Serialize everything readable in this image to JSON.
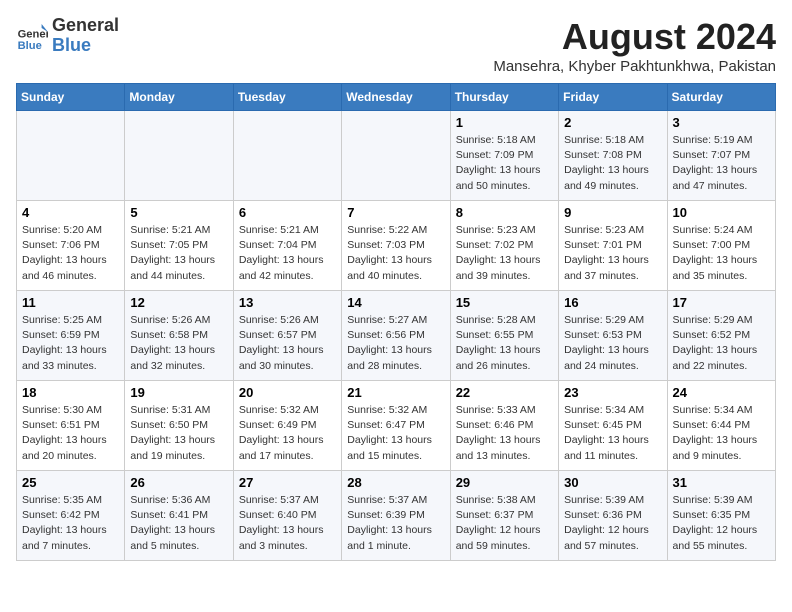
{
  "logo": {
    "general": "General",
    "blue": "Blue"
  },
  "title": "August 2024",
  "subtitle": "Mansehra, Khyber Pakhtunkhwa, Pakistan",
  "days_of_week": [
    "Sunday",
    "Monday",
    "Tuesday",
    "Wednesday",
    "Thursday",
    "Friday",
    "Saturday"
  ],
  "weeks": [
    [
      {
        "day": "",
        "info": ""
      },
      {
        "day": "",
        "info": ""
      },
      {
        "day": "",
        "info": ""
      },
      {
        "day": "",
        "info": ""
      },
      {
        "day": "1",
        "info": "Sunrise: 5:18 AM\nSunset: 7:09 PM\nDaylight: 13 hours\nand 50 minutes."
      },
      {
        "day": "2",
        "info": "Sunrise: 5:18 AM\nSunset: 7:08 PM\nDaylight: 13 hours\nand 49 minutes."
      },
      {
        "day": "3",
        "info": "Sunrise: 5:19 AM\nSunset: 7:07 PM\nDaylight: 13 hours\nand 47 minutes."
      }
    ],
    [
      {
        "day": "4",
        "info": "Sunrise: 5:20 AM\nSunset: 7:06 PM\nDaylight: 13 hours\nand 46 minutes."
      },
      {
        "day": "5",
        "info": "Sunrise: 5:21 AM\nSunset: 7:05 PM\nDaylight: 13 hours\nand 44 minutes."
      },
      {
        "day": "6",
        "info": "Sunrise: 5:21 AM\nSunset: 7:04 PM\nDaylight: 13 hours\nand 42 minutes."
      },
      {
        "day": "7",
        "info": "Sunrise: 5:22 AM\nSunset: 7:03 PM\nDaylight: 13 hours\nand 40 minutes."
      },
      {
        "day": "8",
        "info": "Sunrise: 5:23 AM\nSunset: 7:02 PM\nDaylight: 13 hours\nand 39 minutes."
      },
      {
        "day": "9",
        "info": "Sunrise: 5:23 AM\nSunset: 7:01 PM\nDaylight: 13 hours\nand 37 minutes."
      },
      {
        "day": "10",
        "info": "Sunrise: 5:24 AM\nSunset: 7:00 PM\nDaylight: 13 hours\nand 35 minutes."
      }
    ],
    [
      {
        "day": "11",
        "info": "Sunrise: 5:25 AM\nSunset: 6:59 PM\nDaylight: 13 hours\nand 33 minutes."
      },
      {
        "day": "12",
        "info": "Sunrise: 5:26 AM\nSunset: 6:58 PM\nDaylight: 13 hours\nand 32 minutes."
      },
      {
        "day": "13",
        "info": "Sunrise: 5:26 AM\nSunset: 6:57 PM\nDaylight: 13 hours\nand 30 minutes."
      },
      {
        "day": "14",
        "info": "Sunrise: 5:27 AM\nSunset: 6:56 PM\nDaylight: 13 hours\nand 28 minutes."
      },
      {
        "day": "15",
        "info": "Sunrise: 5:28 AM\nSunset: 6:55 PM\nDaylight: 13 hours\nand 26 minutes."
      },
      {
        "day": "16",
        "info": "Sunrise: 5:29 AM\nSunset: 6:53 PM\nDaylight: 13 hours\nand 24 minutes."
      },
      {
        "day": "17",
        "info": "Sunrise: 5:29 AM\nSunset: 6:52 PM\nDaylight: 13 hours\nand 22 minutes."
      }
    ],
    [
      {
        "day": "18",
        "info": "Sunrise: 5:30 AM\nSunset: 6:51 PM\nDaylight: 13 hours\nand 20 minutes."
      },
      {
        "day": "19",
        "info": "Sunrise: 5:31 AM\nSunset: 6:50 PM\nDaylight: 13 hours\nand 19 minutes."
      },
      {
        "day": "20",
        "info": "Sunrise: 5:32 AM\nSunset: 6:49 PM\nDaylight: 13 hours\nand 17 minutes."
      },
      {
        "day": "21",
        "info": "Sunrise: 5:32 AM\nSunset: 6:47 PM\nDaylight: 13 hours\nand 15 minutes."
      },
      {
        "day": "22",
        "info": "Sunrise: 5:33 AM\nSunset: 6:46 PM\nDaylight: 13 hours\nand 13 minutes."
      },
      {
        "day": "23",
        "info": "Sunrise: 5:34 AM\nSunset: 6:45 PM\nDaylight: 13 hours\nand 11 minutes."
      },
      {
        "day": "24",
        "info": "Sunrise: 5:34 AM\nSunset: 6:44 PM\nDaylight: 13 hours\nand 9 minutes."
      }
    ],
    [
      {
        "day": "25",
        "info": "Sunrise: 5:35 AM\nSunset: 6:42 PM\nDaylight: 13 hours\nand 7 minutes."
      },
      {
        "day": "26",
        "info": "Sunrise: 5:36 AM\nSunset: 6:41 PM\nDaylight: 13 hours\nand 5 minutes."
      },
      {
        "day": "27",
        "info": "Sunrise: 5:37 AM\nSunset: 6:40 PM\nDaylight: 13 hours\nand 3 minutes."
      },
      {
        "day": "28",
        "info": "Sunrise: 5:37 AM\nSunset: 6:39 PM\nDaylight: 13 hours\nand 1 minute."
      },
      {
        "day": "29",
        "info": "Sunrise: 5:38 AM\nSunset: 6:37 PM\nDaylight: 12 hours\nand 59 minutes."
      },
      {
        "day": "30",
        "info": "Sunrise: 5:39 AM\nSunset: 6:36 PM\nDaylight: 12 hours\nand 57 minutes."
      },
      {
        "day": "31",
        "info": "Sunrise: 5:39 AM\nSunset: 6:35 PM\nDaylight: 12 hours\nand 55 minutes."
      }
    ]
  ]
}
